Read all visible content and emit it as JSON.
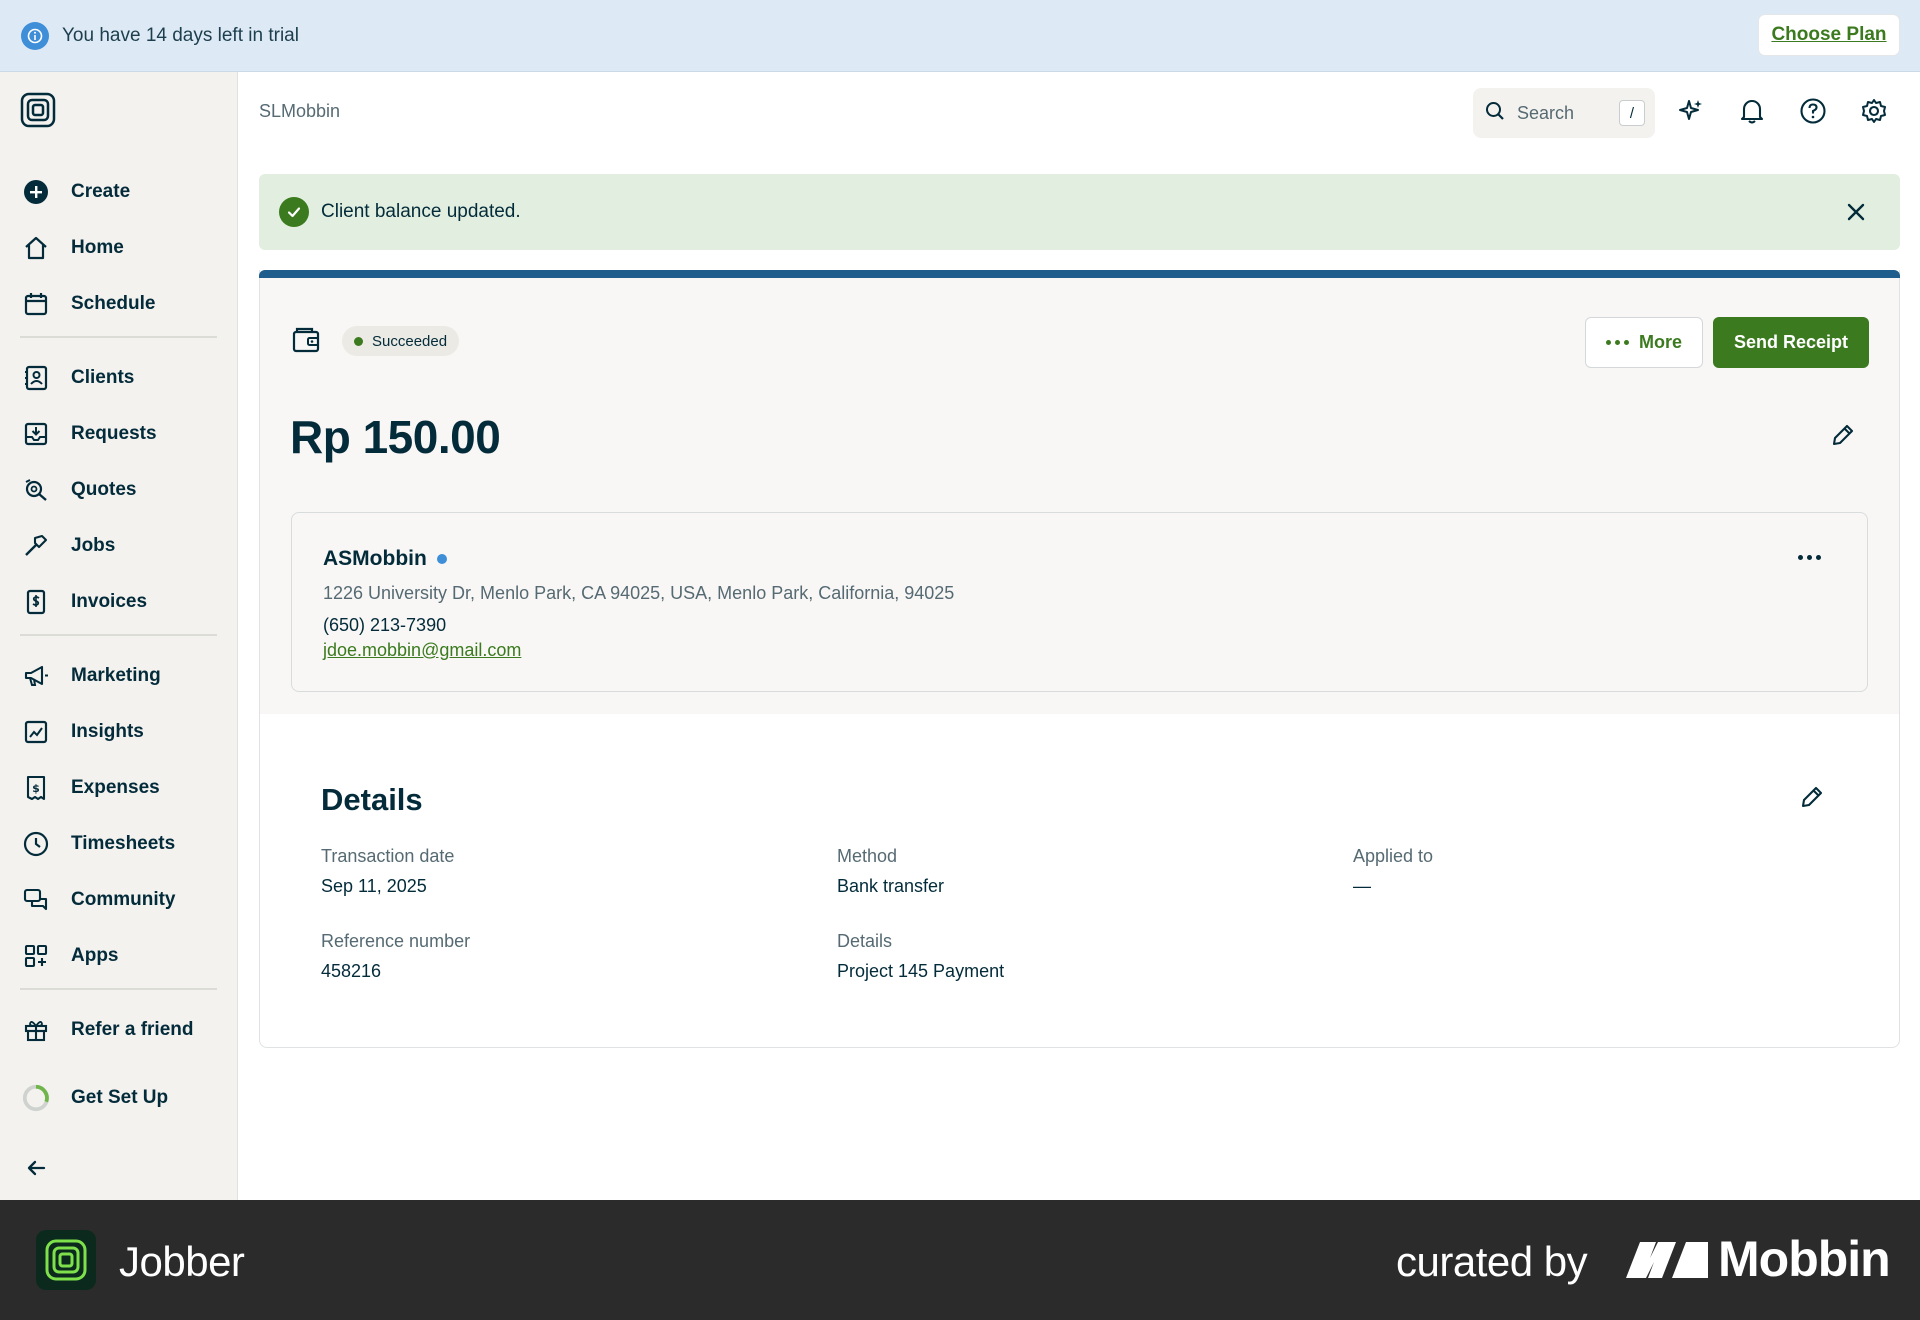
{
  "trial_banner": {
    "text": "You have 14 days left in trial",
    "cta": "Choose Plan"
  },
  "sidebar": {
    "groups": [
      [
        {
          "label": "Create",
          "icon": "plus-circle-icon"
        },
        {
          "label": "Home",
          "icon": "home-icon"
        },
        {
          "label": "Schedule",
          "icon": "calendar-icon"
        }
      ],
      [
        {
          "label": "Clients",
          "icon": "contact-book-icon"
        },
        {
          "label": "Requests",
          "icon": "inbox-download-icon"
        },
        {
          "label": "Quotes",
          "icon": "quote-search-icon"
        },
        {
          "label": "Jobs",
          "icon": "hammer-icon"
        },
        {
          "label": "Invoices",
          "icon": "invoice-dollar-icon"
        }
      ],
      [
        {
          "label": "Marketing",
          "icon": "megaphone-icon"
        },
        {
          "label": "Insights",
          "icon": "chart-icon"
        },
        {
          "label": "Expenses",
          "icon": "receipt-icon"
        },
        {
          "label": "Timesheets",
          "icon": "clock-icon"
        },
        {
          "label": "Community",
          "icon": "chat-bubbles-icon"
        },
        {
          "label": "Apps",
          "icon": "apps-grid-icon"
        }
      ]
    ],
    "refer": "Refer a friend",
    "get_set_up": "Get Set Up"
  },
  "header": {
    "breadcrumb": "SLMobbin",
    "search_placeholder": "Search",
    "search_shortcut": "/"
  },
  "toast": {
    "message": "Client balance updated."
  },
  "payment": {
    "status": "Succeeded",
    "more_label": "More",
    "send_receipt_label": "Send Receipt",
    "amount": "Rp 150.00"
  },
  "client": {
    "name": "ASMobbin",
    "address": "1226 University Dr, Menlo Park, CA 94025, USA, Menlo Park, California, 94025",
    "phone": "(650) 213-7390",
    "email": "jdoe.mobbin@gmail.com"
  },
  "details": {
    "title": "Details",
    "fields": {
      "transaction_date": {
        "label": "Transaction date",
        "value": "Sep 11, 2025"
      },
      "method": {
        "label": "Method",
        "value": "Bank transfer"
      },
      "applied_to": {
        "label": "Applied to",
        "value": "—"
      },
      "reference_number": {
        "label": "Reference number",
        "value": "458216"
      },
      "details": {
        "label": "Details",
        "value": "Project 145 Payment"
      }
    }
  },
  "footer": {
    "brand": "Jobber",
    "curated_by": "curated by",
    "curator": "Mobbin"
  },
  "colors": {
    "primary_green": "#3b7a1e",
    "navy_text": "#032b3a",
    "accent_blue": "#1f5d8d",
    "info_blue": "#3f8ed8"
  }
}
